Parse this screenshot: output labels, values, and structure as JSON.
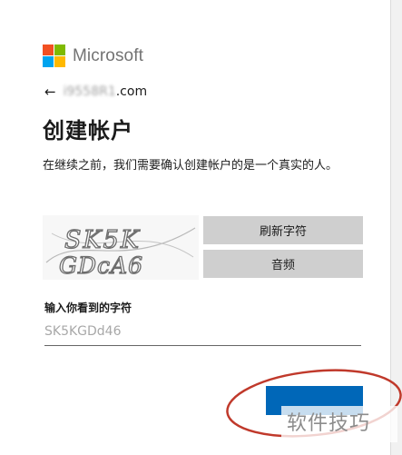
{
  "brand": {
    "name": "Microsoft",
    "logo_colors": [
      "#f25022",
      "#7fba00",
      "#00a4ef",
      "#ffb900"
    ]
  },
  "account": {
    "back_icon": "back-arrow-icon",
    "email_obscured": "i9558R1",
    "email_suffix": ".com"
  },
  "page": {
    "title": "创建帐户",
    "description": "在继续之前，我们需要确认创建帐户的是一个真实的人。"
  },
  "captcha": {
    "image_text": "SK5KGDcA6",
    "refresh_label": "刷新字符",
    "audio_label": "音频",
    "input_label": "输入你看到的字符",
    "input_value": "SK5KGDd46"
  },
  "actions": {
    "next_button_color": "#0067b8",
    "highlight_color": "#c0392b"
  },
  "watermark": {
    "text": "软件技巧"
  }
}
